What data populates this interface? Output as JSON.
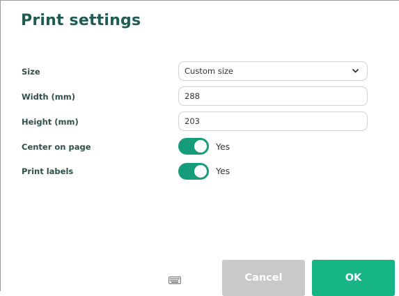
{
  "dialog": {
    "title": "Print settings"
  },
  "fields": {
    "size_label": "Size",
    "size_value": "Custom size",
    "width_label": "Width (mm)",
    "width_value": "288",
    "height_label": "Height (mm)",
    "height_value": "203",
    "center_label": "Center on page",
    "center_state": "Yes",
    "labels_label": "Print labels",
    "labels_state": "Yes"
  },
  "buttons": {
    "cancel": "Cancel",
    "ok": "OK"
  },
  "colors": {
    "title": "#1e5b52",
    "toggle_on": "#169c7a",
    "ok_button": "#17b485",
    "cancel_button": "#c9c9c9"
  },
  "icons": {
    "size_dropdown": "chevron-down-icon",
    "keyboard": "keyboard-icon"
  }
}
